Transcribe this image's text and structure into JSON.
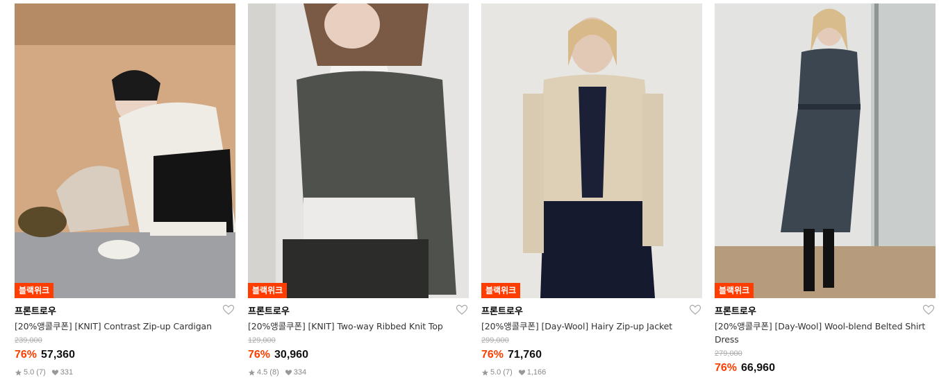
{
  "products": [
    {
      "badge": "블랙위크",
      "brand": "프론트로우",
      "name": "[20%앵콜쿠폰] [KNIT] Contrast Zip-up Cardigan",
      "original_price": "239,000",
      "discount": "76%",
      "price": "57,360",
      "rating": "5.0",
      "reviews": "(7)",
      "likes": "331"
    },
    {
      "badge": "블랙위크",
      "brand": "프론트로우",
      "name": "[20%앵콜쿠폰] [KNIT] Two-way Ribbed Knit Top",
      "original_price": "129,000",
      "discount": "76%",
      "price": "30,960",
      "rating": "4.5",
      "reviews": "(8)",
      "likes": "334"
    },
    {
      "badge": "블랙위크",
      "brand": "프론트로우",
      "name": "[20%앵콜쿠폰] [Day-Wool] Hairy Zip-up Jacket",
      "original_price": "299,000",
      "discount": "76%",
      "price": "71,760",
      "rating": "5.0",
      "reviews": "(7)",
      "likes": "1,166"
    },
    {
      "badge": "블랙위크",
      "brand": "프론트로우",
      "name": "[20%앵콜쿠폰] [Day-Wool] Wool-blend Belted Shirt Dress",
      "original_price": "279,000",
      "discount": "76%",
      "price": "66,960"
    }
  ],
  "colors": {
    "accent": "#ff3d00",
    "text": "#222222",
    "muted": "#888888"
  },
  "icons": {
    "wishlist": "heart-outline-icon",
    "rating": "star-icon",
    "likes": "heart-filled-icon"
  }
}
